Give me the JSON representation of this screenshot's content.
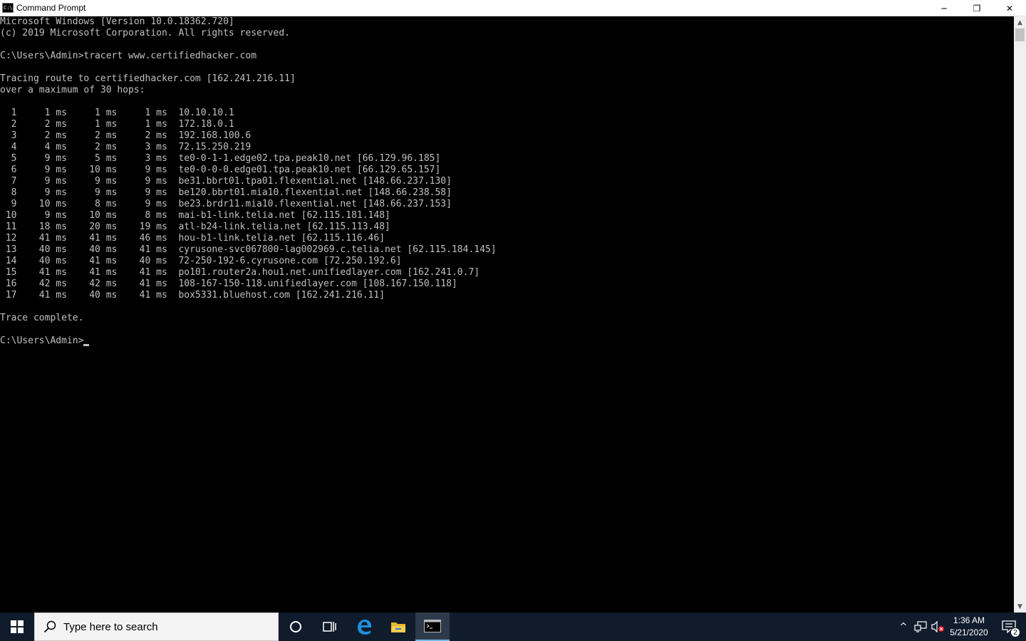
{
  "window": {
    "title": "Command Prompt",
    "icon_label": "C:\\",
    "minimize_glyph": "─",
    "maximize_glyph": "❐",
    "close_glyph": "✕"
  },
  "console": {
    "lines": [
      "Microsoft Windows [Version 10.0.18362.720]",
      "(c) 2019 Microsoft Corporation. All rights reserved.",
      "",
      "C:\\Users\\Admin>tracert www.certifiedhacker.com",
      "",
      "Tracing route to certifiedhacker.com [162.241.216.11]",
      "over a maximum of 30 hops:",
      "",
      "  1     1 ms     1 ms     1 ms  10.10.10.1",
      "  2     2 ms     1 ms     1 ms  172.18.0.1",
      "  3     2 ms     2 ms     2 ms  192.168.100.6",
      "  4     4 ms     2 ms     3 ms  72.15.250.219",
      "  5     9 ms     5 ms     3 ms  te0-0-1-1.edge02.tpa.peak10.net [66.129.96.185]",
      "  6     9 ms    10 ms     9 ms  te0-0-0-0.edge01.tpa.peak10.net [66.129.65.157]",
      "  7     9 ms     9 ms     9 ms  be31.bbrt01.tpa01.flexential.net [148.66.237.130]",
      "  8     9 ms     9 ms     9 ms  be120.bbrt01.mia10.flexential.net [148.66.238.58]",
      "  9    10 ms     8 ms     9 ms  be23.brdr11.mia10.flexential.net [148.66.237.153]",
      " 10     9 ms    10 ms     8 ms  mai-b1-link.telia.net [62.115.181.148]",
      " 11    18 ms    20 ms    19 ms  atl-b24-link.telia.net [62.115.113.48]",
      " 12    41 ms    41 ms    46 ms  hou-b1-link.telia.net [62.115.116.46]",
      " 13    40 ms    40 ms    41 ms  cyrusone-svc067800-lag002969.c.telia.net [62.115.184.145]",
      " 14    40 ms    41 ms    40 ms  72-250-192-6.cyrusone.com [72.250.192.6]",
      " 15    41 ms    41 ms    41 ms  po101.router2a.hou1.net.unifiedlayer.com [162.241.0.7]",
      " 16    42 ms    42 ms    41 ms  108-167-150-118.unifiedlayer.com [108.167.150.118]",
      " 17    41 ms    40 ms    41 ms  box5331.bluehost.com [162.241.216.11]",
      "",
      "Trace complete.",
      ""
    ],
    "prompt": "C:\\Users\\Admin>"
  },
  "taskbar": {
    "search_placeholder": "Type here to search",
    "clock_time": "1:36 AM",
    "clock_date": "5/21/2020",
    "notification_count": "2",
    "tray_chevron": "^"
  },
  "colors": {
    "console_bg": "#000000",
    "console_text": "#c0c0c0",
    "taskbar_bg": "#101c2c",
    "accent": "#76b9ed"
  }
}
